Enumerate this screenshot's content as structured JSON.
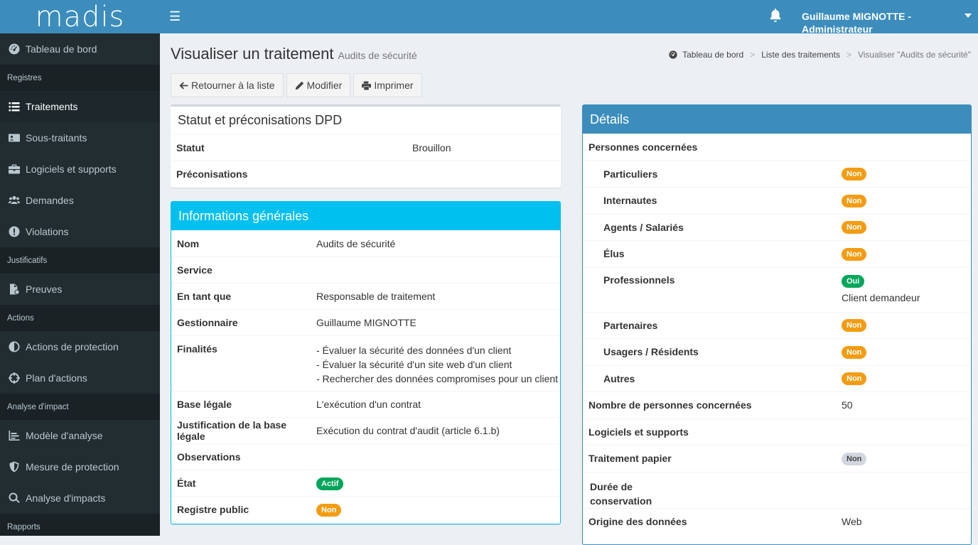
{
  "topbar": {
    "logo_text": "madis",
    "user_label": "Guillaume MIGNOTTE - Administrateur"
  },
  "sidebar": {
    "items": [
      {
        "type": "item",
        "label": "Tableau de bord",
        "icon": "dashboard-icon"
      },
      {
        "type": "header",
        "label": "Registres"
      },
      {
        "type": "item",
        "label": "Traitements",
        "icon": "list-icon",
        "active": true
      },
      {
        "type": "item",
        "label": "Sous-traitants",
        "icon": "id-card-icon"
      },
      {
        "type": "item",
        "label": "Logiciels et supports",
        "icon": "briefcase-icon"
      },
      {
        "type": "item",
        "label": "Demandes",
        "icon": "users-icon"
      },
      {
        "type": "item",
        "label": "Violations",
        "icon": "exclamation-circle-icon"
      },
      {
        "type": "header",
        "label": "Justificatifs"
      },
      {
        "type": "item",
        "label": "Preuves",
        "icon": "file-icon"
      },
      {
        "type": "header",
        "label": "Actions"
      },
      {
        "type": "item",
        "label": "Actions de protection",
        "icon": "adjust-icon"
      },
      {
        "type": "item",
        "label": "Plan d'actions",
        "icon": "crosshairs-icon"
      },
      {
        "type": "header",
        "label": "Analyse d'impact"
      },
      {
        "type": "item",
        "label": "Modèle d'analyse",
        "icon": "chart-icon"
      },
      {
        "type": "item",
        "label": "Mesure de protection",
        "icon": "shield-icon"
      },
      {
        "type": "item",
        "label": "Analyse d'impacts",
        "icon": "search-icon"
      },
      {
        "type": "header",
        "label": "Rapports"
      }
    ]
  },
  "page": {
    "title": "Visualiser un traitement",
    "subtitle": "Audits de sécurité"
  },
  "breadcrumb": {
    "home": "Tableau de bord",
    "list": "Liste des traitements",
    "current": "Visualiser \"Audits de sécurité\""
  },
  "actions": {
    "back": "Retourner à la liste",
    "edit": "Modifier",
    "print": "Imprimer"
  },
  "status_box": {
    "title": "Statut et préconisations DPD",
    "rows": [
      {
        "label": "Statut",
        "value": "Brouillon"
      },
      {
        "label": "Préconisations",
        "value": ""
      }
    ]
  },
  "general_box": {
    "title": "Informations générales",
    "rows": [
      {
        "label": "Nom",
        "lines": [
          "Audits de sécurité"
        ]
      },
      {
        "label": "Service",
        "lines": []
      },
      {
        "label": "En tant que",
        "lines": [
          "Responsable de traitement"
        ]
      },
      {
        "label": "Gestionnaire",
        "lines": [
          "Guillaume MIGNOTTE"
        ]
      },
      {
        "label": "Finalités",
        "lines": [
          "- Évaluer la sécurité des données d'un client",
          "- Évaluer la sécurité d'un site web d'un client",
          "- Rechercher des données compromises pour un client"
        ]
      },
      {
        "label": "Base légale",
        "lines": [
          "L'exécution d'un contrat"
        ]
      },
      {
        "label": "Justification de la base légale",
        "lines": [
          "Exécution du contrat d'audit (article 6.1.b)"
        ]
      },
      {
        "label": "Observations",
        "lines": []
      },
      {
        "label": "État",
        "badge": "Actif",
        "badge_color": "#00a65a"
      },
      {
        "label": "Registre public",
        "badge": "Non",
        "badge_color": "#f39c12"
      }
    ]
  },
  "details_box": {
    "title": "Détails",
    "rows": [
      {
        "label": "Personnes concernées",
        "indent": false
      },
      {
        "label": "Particuliers",
        "indent": true,
        "badge": "Non",
        "badge_color": "#f39c12"
      },
      {
        "label": "Internautes",
        "indent": true,
        "badge": "Non",
        "badge_color": "#f39c12"
      },
      {
        "label": "Agents / Salariés",
        "indent": true,
        "badge": "Non",
        "badge_color": "#f39c12"
      },
      {
        "label": "Élus",
        "indent": true,
        "badge": "Non",
        "badge_color": "#f39c12"
      },
      {
        "label": "Professionnels",
        "indent": true,
        "badge": "Oui",
        "badge_color": "#00a65a",
        "note": "Client demandeur"
      },
      {
        "label": "Partenaires",
        "indent": true,
        "badge": "Non",
        "badge_color": "#f39c12"
      },
      {
        "label": "Usagers / Résidents",
        "indent": true,
        "badge": "Non",
        "badge_color": "#f39c12"
      },
      {
        "label": "Autres",
        "indent": true,
        "badge": "Non",
        "badge_color": "#f39c12"
      },
      {
        "label": "Nombre de personnes concernées",
        "indent": false,
        "value": "50"
      },
      {
        "label": "Logiciels et supports",
        "indent": false
      },
      {
        "label": "Traitement papier",
        "indent": false,
        "badge": "Non",
        "badge_color": "#d2d6de"
      },
      {
        "label": "Durée de\nconservation",
        "indent": false,
        "wrap": true
      },
      {
        "label": "Origine des données",
        "indent": false,
        "value": "Web"
      }
    ]
  }
}
